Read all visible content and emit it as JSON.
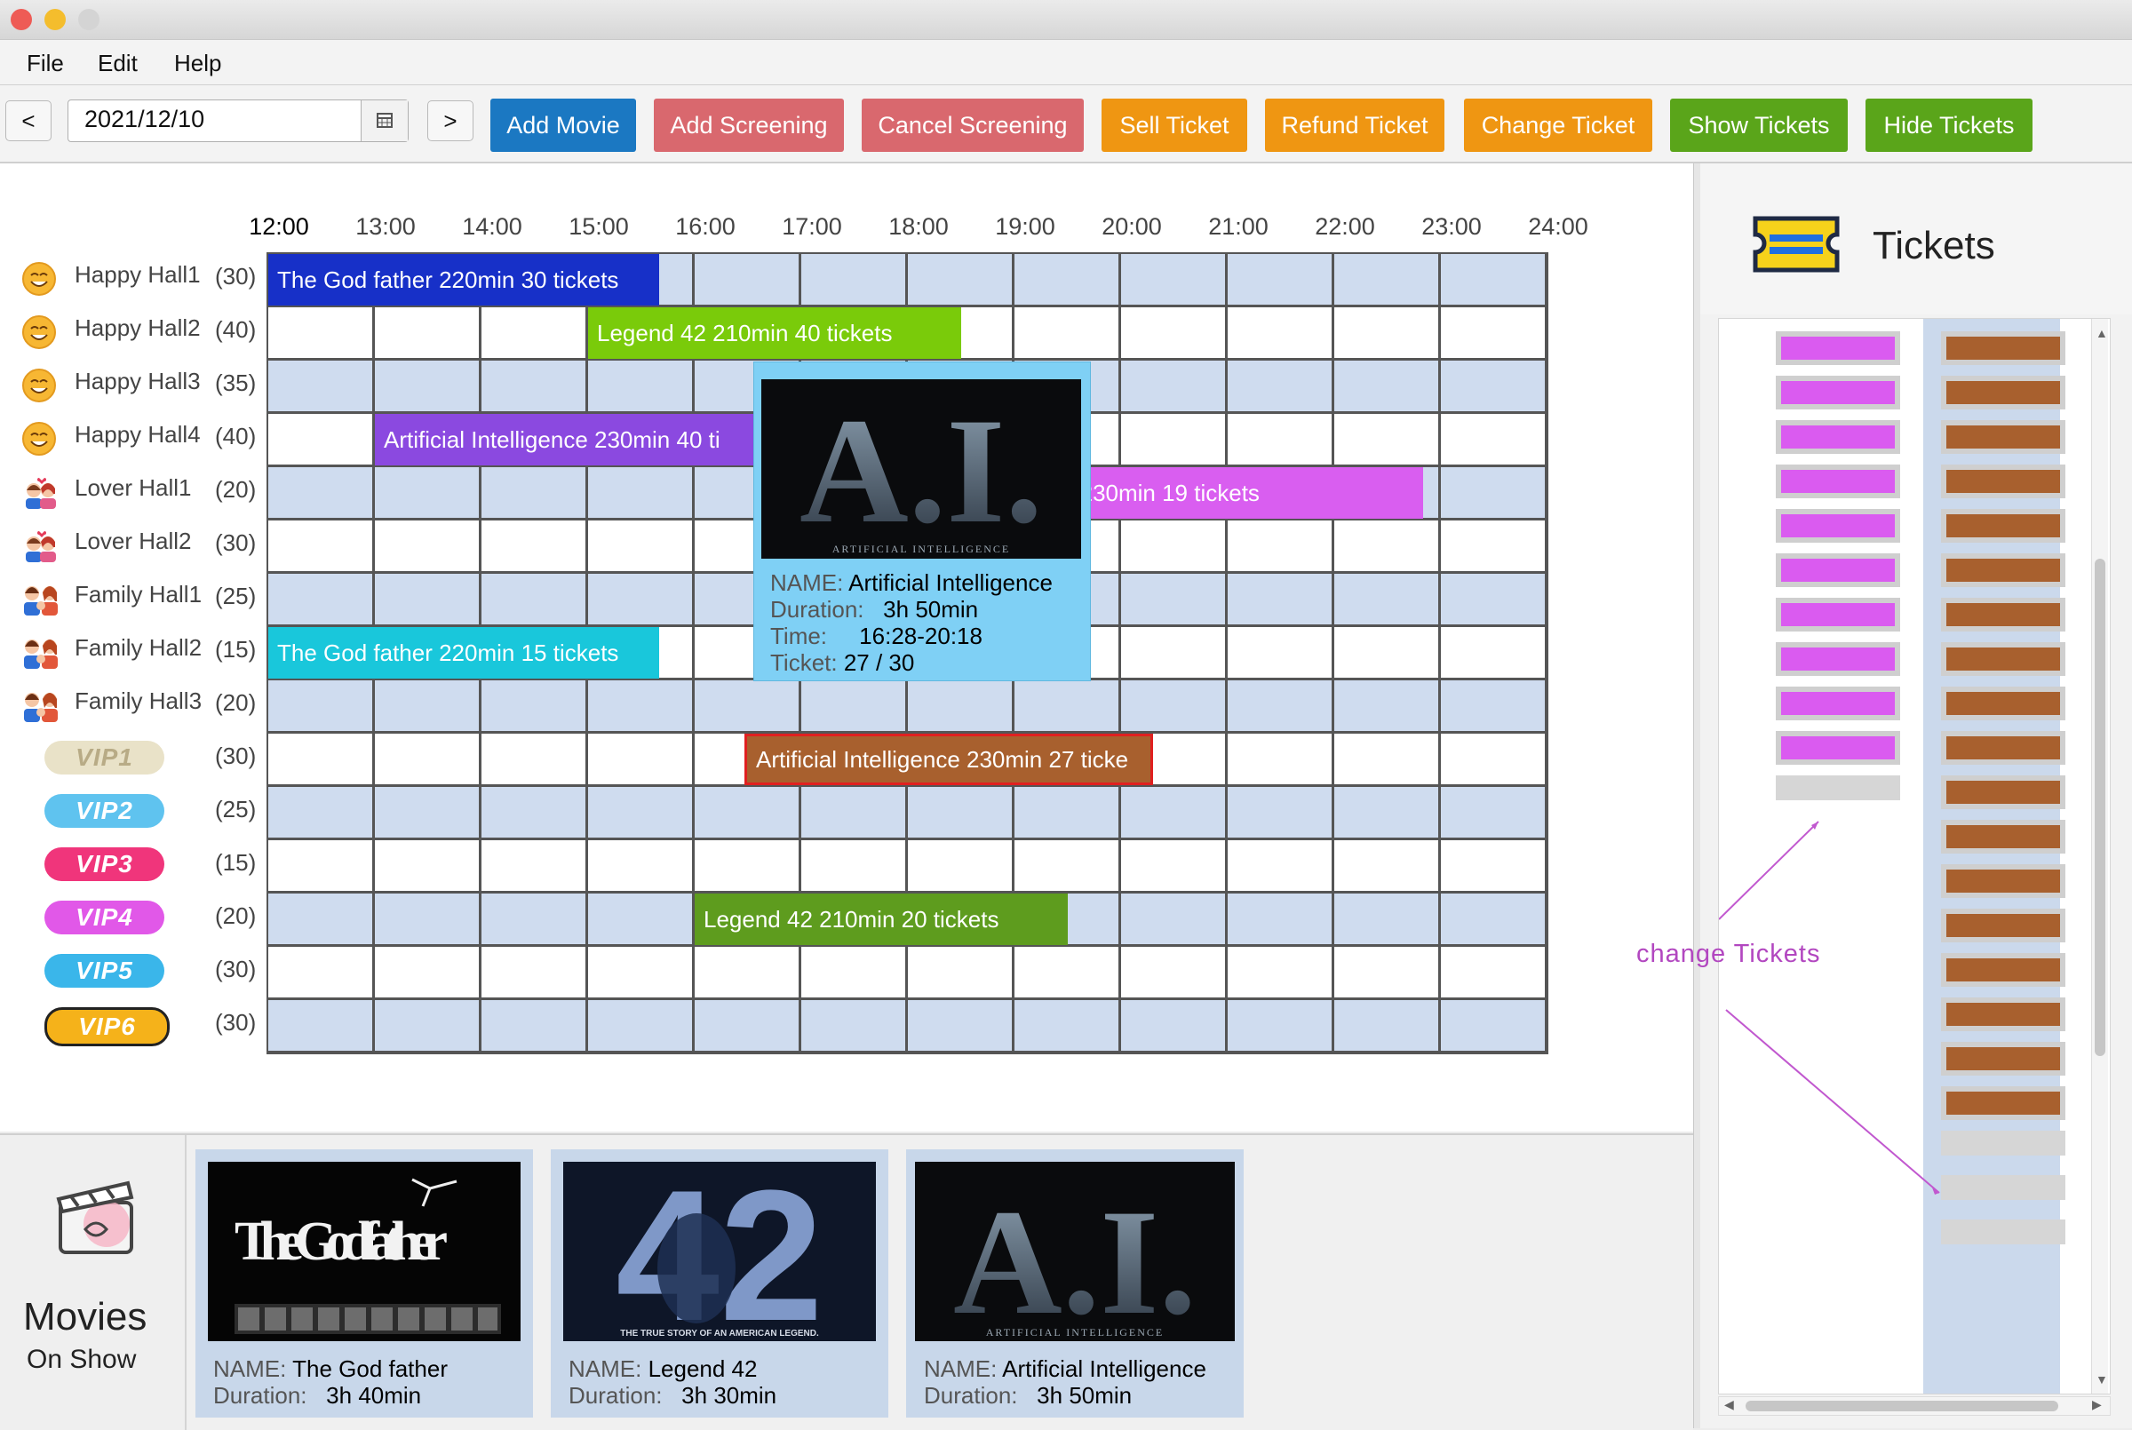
{
  "menu": {
    "items": [
      "File",
      "Edit",
      "Help"
    ]
  },
  "toolbar": {
    "prev_label": "<",
    "next_label": ">",
    "date_value": "2021/12/10",
    "buttons": [
      {
        "label": "Add Movie",
        "color": "#1b78c2"
      },
      {
        "label": "Add Screening",
        "color": "#d9686e"
      },
      {
        "label": "Cancel Screening",
        "color": "#d9686e"
      },
      {
        "label": "Sell Ticket",
        "color": "#ef9612"
      },
      {
        "label": "Refund Ticket",
        "color": "#ef9612"
      },
      {
        "label": "Change Ticket",
        "color": "#ef9612"
      },
      {
        "label": "Show Tickets",
        "color": "#5aa51a"
      },
      {
        "label": "Hide Tickets",
        "color": "#5aa51a"
      }
    ]
  },
  "schedule": {
    "times": [
      "12:00",
      "13:00",
      "14:00",
      "15:00",
      "16:00",
      "17:00",
      "18:00",
      "19:00",
      "20:00",
      "21:00",
      "22:00",
      "23:00",
      "24:00"
    ],
    "halls": [
      {
        "name": "Happy Hall1",
        "capacity": "(30)",
        "icon": "smiley-icon"
      },
      {
        "name": "Happy Hall2",
        "capacity": "(40)",
        "icon": "smiley-icon"
      },
      {
        "name": "Happy Hall3",
        "capacity": "(35)",
        "icon": "smiley-icon"
      },
      {
        "name": "Happy Hall4",
        "capacity": "(40)",
        "icon": "smiley-icon"
      },
      {
        "name": "Lover Hall1",
        "capacity": "(20)",
        "icon": "couple-icon"
      },
      {
        "name": "Lover Hall2",
        "capacity": "(30)",
        "icon": "couple-icon"
      },
      {
        "name": "Family Hall1",
        "capacity": "(25)",
        "icon": "family-icon"
      },
      {
        "name": "Family Hall2",
        "capacity": "(15)",
        "icon": "family-icon"
      },
      {
        "name": "Family Hall3",
        "capacity": "(20)",
        "icon": "family-icon"
      },
      {
        "name": "VIP1",
        "capacity": "(30)",
        "icon": "vip1-badge-icon"
      },
      {
        "name": "VIP2",
        "capacity": "(25)",
        "icon": "vip2-badge-icon"
      },
      {
        "name": "VIP3",
        "capacity": "(15)",
        "icon": "vip3-badge-icon"
      },
      {
        "name": "VIP4",
        "capacity": "(20)",
        "icon": "vip4-badge-icon"
      },
      {
        "name": "VIP5",
        "capacity": "(30)",
        "icon": "vip5-badge-icon"
      },
      {
        "name": "VIP6",
        "capacity": "(30)",
        "icon": "vip6-badge-icon"
      }
    ],
    "vip_colors": [
      "#e9e2c8",
      "#5fc3ef",
      "#f0357b",
      "#e158e8",
      "#3ab6ea",
      "#f5b21a"
    ],
    "screenings": [
      {
        "label": "The God father 220min  30 tickets",
        "color": "#1730c8",
        "hall": 0,
        "start": "12:00"
      },
      {
        "label": "Legend 42 210min  40 tickets",
        "color": "#7acb0a",
        "hall": 1,
        "start": "15:00"
      },
      {
        "label": "Artificial Intelligence 230min  40 ti",
        "color": "#8b49e0",
        "hall": 3,
        "start": "13:00"
      },
      {
        "label": "ence 230min  19 tickets",
        "color": "#d95ef0",
        "hall": 4,
        "start": "19:00"
      },
      {
        "label": "The God father 220min  15 tickets",
        "color": "#19c7db",
        "hall": 7,
        "start": "12:00"
      },
      {
        "label": "Artificial Intelligence 230min  27 ticke",
        "color": "#a8602e",
        "hall": 9,
        "start": "16:28"
      },
      {
        "label": "Legend 42 210min  20 tickets",
        "color": "#5e9c1e",
        "hall": 12,
        "start": "16:00"
      }
    ]
  },
  "tooltip": {
    "name_key": "NAME:",
    "name": "Artificial Intelligence",
    "duration_key": "Duration:",
    "duration": "3h 50min",
    "time_key": "Time:",
    "time": "16:28-20:18",
    "ticket_key": "Ticket:",
    "ticket": "27 / 30"
  },
  "movies_panel": {
    "title": "Movies",
    "subtitle": "On Show",
    "movies": [
      {
        "name_key": "NAME:",
        "name": "The God father",
        "duration_key": "Duration:",
        "duration": "3h 40min",
        "poster_text": "The Godfather"
      },
      {
        "name_key": "NAME:",
        "name": "Legend 42",
        "duration_key": "Duration:",
        "duration": "3h 30min",
        "poster_text": "42",
        "poster_caption": "THE TRUE STORY OF AN AMERICAN LEGEND."
      },
      {
        "name_key": "NAME:",
        "name": "Artificial Intelligence",
        "duration_key": "Duration:",
        "duration": "3h 50min",
        "poster_text": "A.I.",
        "poster_caption": "ARTIFICIAL INTELLIGENCE"
      }
    ]
  },
  "tickets_panel": {
    "title": "Tickets",
    "annotation": "change Tickets",
    "left_sold": 10,
    "left_total": 11,
    "right_sold": 18,
    "right_total": 21
  },
  "tooltip_poster": {
    "poster_text": "A.I.",
    "poster_caption": "ARTIFICIAL INTELLIGENCE"
  }
}
